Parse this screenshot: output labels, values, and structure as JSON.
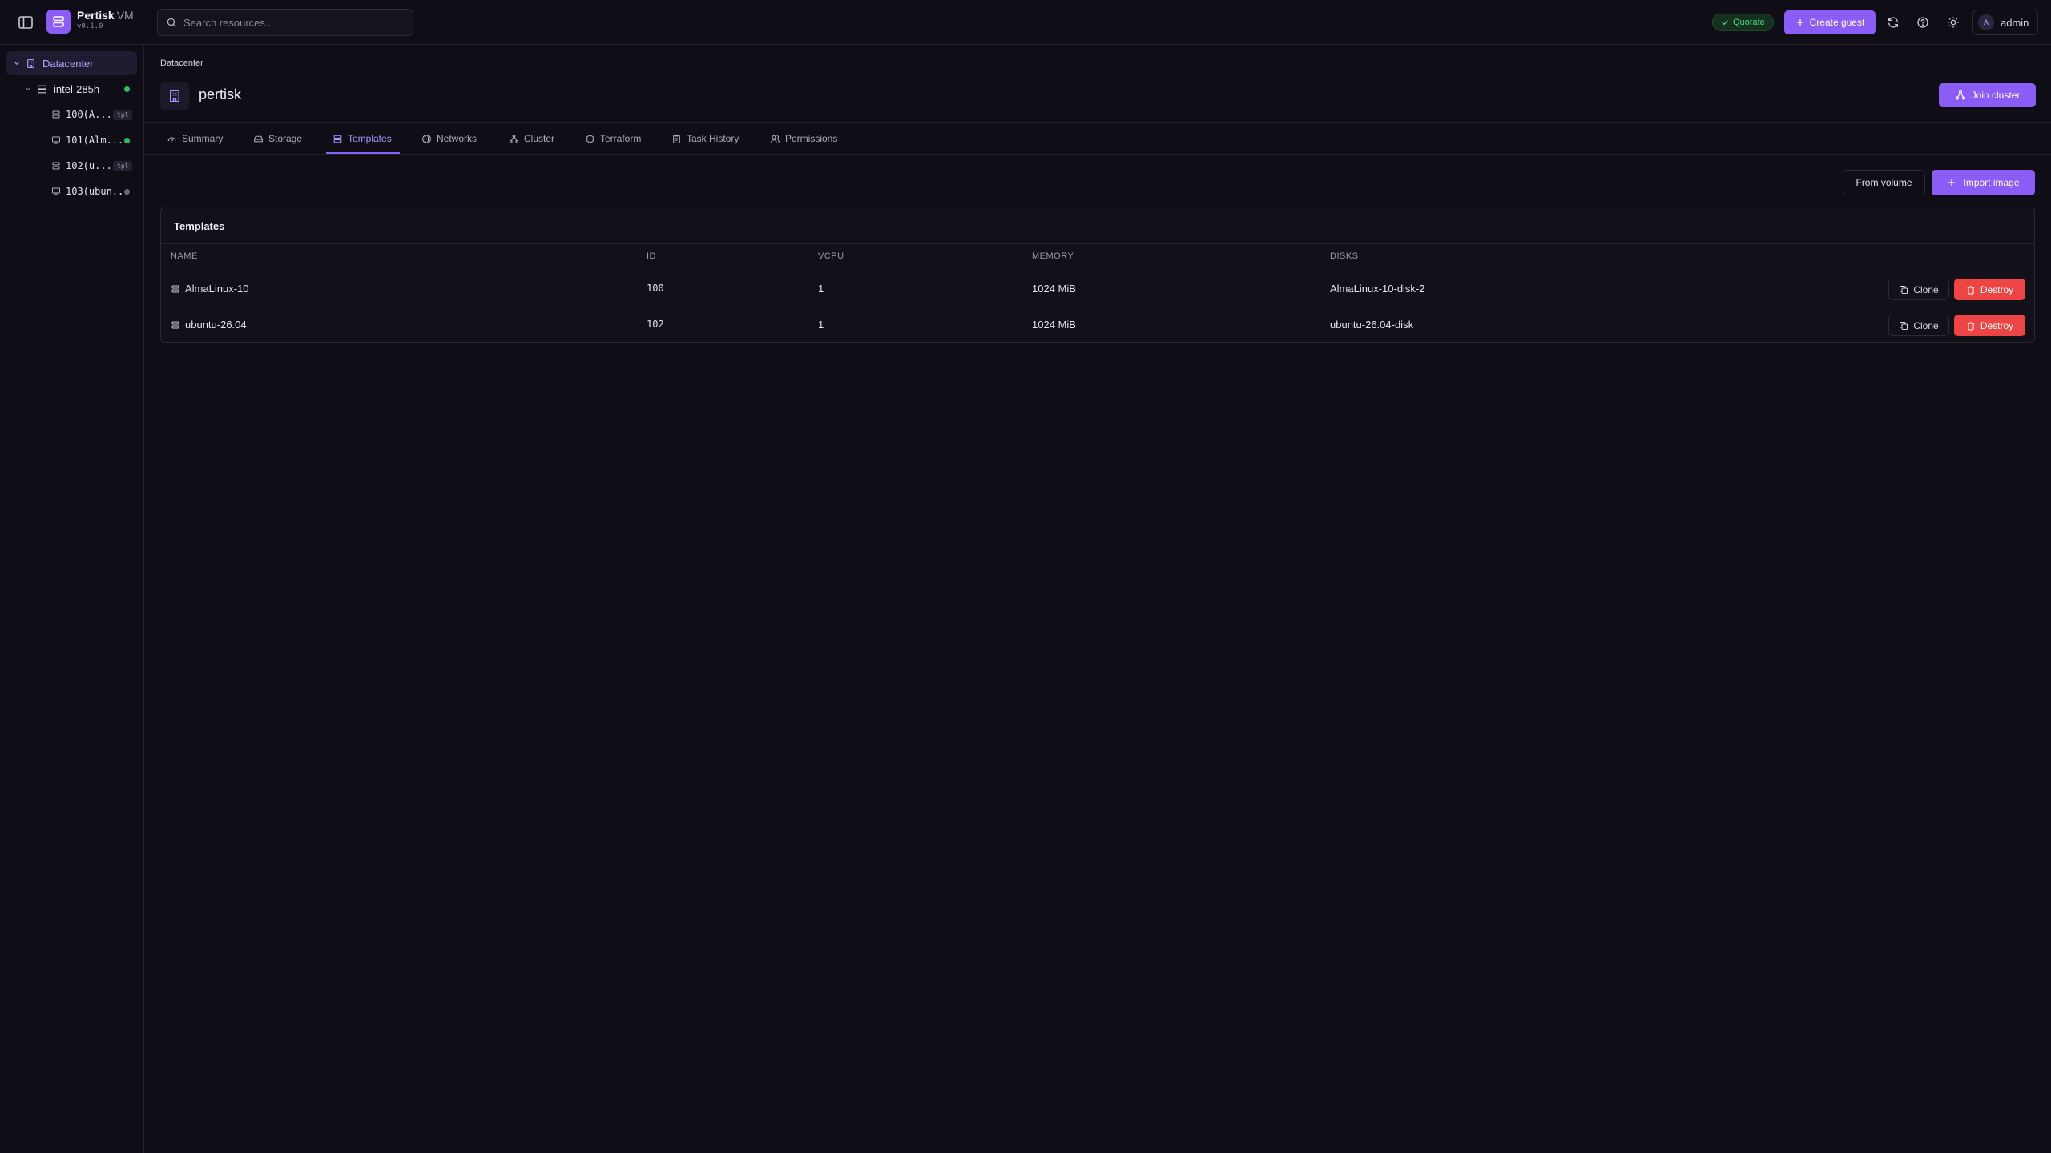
{
  "app": {
    "name": "Pertisk",
    "name_suffix": "VM",
    "version": "v0.1.0"
  },
  "topbar": {
    "search_placeholder": "Search resources...",
    "status_badge": "Quorate",
    "create_guest_label": "Create guest",
    "user_initial": "A",
    "user_name": "admin"
  },
  "sidebar": {
    "datacenter_label": "Datacenter",
    "node": {
      "label": "intel-285h",
      "status": "online"
    },
    "guests": [
      {
        "label": "100(A...",
        "badge": "tpl"
      },
      {
        "label": "101(Alm...",
        "status": "running"
      },
      {
        "label": "102(u...",
        "badge": "tpl"
      },
      {
        "label": "103(ubun...",
        "status": "stopped"
      }
    ]
  },
  "page": {
    "breadcrumb": "Datacenter",
    "title": "pertisk",
    "join_cluster_label": "Join cluster"
  },
  "tabs": [
    {
      "label": "Summary",
      "icon": "gauge-icon"
    },
    {
      "label": "Storage",
      "icon": "hard-drive-icon"
    },
    {
      "label": "Templates",
      "icon": "template-icon",
      "active": true
    },
    {
      "label": "Networks",
      "icon": "globe-icon"
    },
    {
      "label": "Cluster",
      "icon": "cluster-icon"
    },
    {
      "label": "Terraform",
      "icon": "terraform-icon"
    },
    {
      "label": "Task History",
      "icon": "clipboard-icon"
    },
    {
      "label": "Permissions",
      "icon": "users-icon"
    }
  ],
  "actions": {
    "from_volume_label": "From volume",
    "import_image_label": "Import image"
  },
  "templates_table": {
    "title": "Templates",
    "columns": [
      "NAME",
      "ID",
      "VCPU",
      "MEMORY",
      "DISKS"
    ],
    "rows": [
      {
        "name": "AlmaLinux-10",
        "id": "100",
        "vcpu": "1",
        "memory": "1024 MiB",
        "disks": "AlmaLinux-10-disk-2"
      },
      {
        "name": "ubuntu-26.04",
        "id": "102",
        "vcpu": "1",
        "memory": "1024 MiB",
        "disks": "ubuntu-26.04-disk"
      }
    ],
    "clone_label": "Clone",
    "destroy_label": "Destroy"
  },
  "colors": {
    "accent": "#8b5cf6",
    "danger": "#ef4444",
    "success": "#4ade80",
    "background": "#0f0e17"
  }
}
